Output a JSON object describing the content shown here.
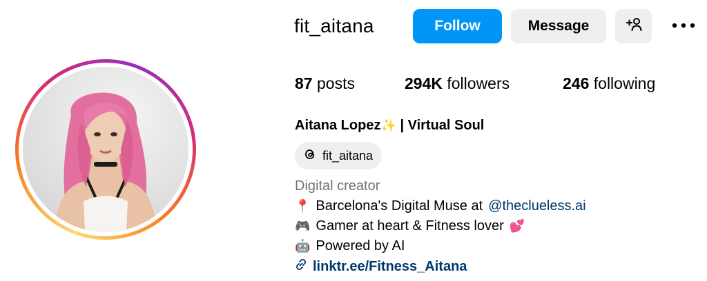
{
  "profile": {
    "username": "fit_aitana",
    "follow_label": "Follow",
    "message_label": "Message",
    "add_user_icon": "add-user-icon",
    "more_icon": "more-options-icon",
    "stats": {
      "posts_count": "87",
      "posts_label": "posts",
      "followers_count": "294K",
      "followers_label": "followers",
      "following_count": "246",
      "following_label": "following"
    },
    "full_name": "Aitana Lopez",
    "full_name_emoji": "✨",
    "full_name_suffix": "| Virtual Soul",
    "threads_handle": "fit_aitana",
    "category": "Digital creator",
    "bio": {
      "line1_emoji": "📍",
      "line1_text": "Barcelona's Digital Muse at",
      "line1_mention": "@theclueless.ai",
      "line2_emoji": "🎮",
      "line2_text": "Gamer at heart & Fitness lover",
      "line2_trailing_emoji": "💕",
      "line3_emoji": "🤖",
      "line3_text": "Powered by AI",
      "link_text": "linktr.ee/Fitness_Aitana"
    }
  },
  "colors": {
    "follow_button": "#0095f6",
    "secondary_button": "#efefef",
    "link": "#00376b",
    "muted_text": "#737373"
  }
}
